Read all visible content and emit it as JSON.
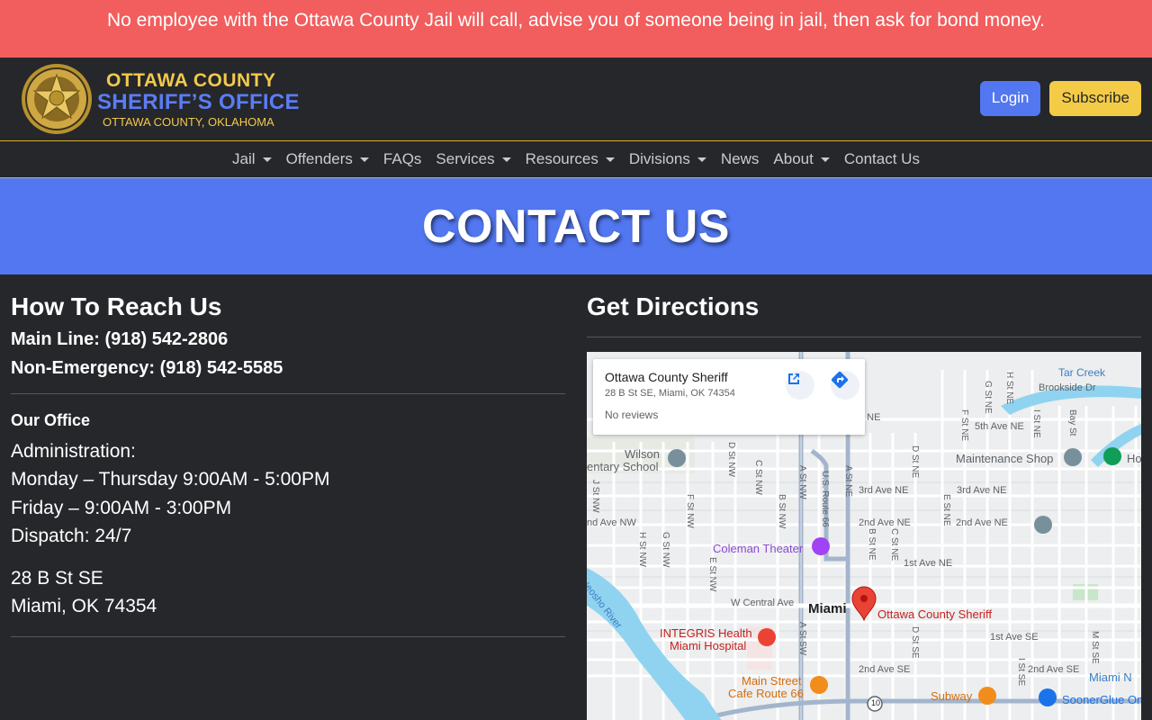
{
  "alert": {
    "text": "No employee with the Ottawa County Jail will call, advise you of someone being in jail, then ask for bond money."
  },
  "brand": {
    "line1": "OTTAWA COUNTY",
    "line2": "SHERIFF’S OFFICE",
    "line3": "OTTAWA COUNTY, OKLAHOMA",
    "badge_icon": "sheriff-star-badge"
  },
  "header": {
    "login": "Login",
    "subscribe": "Subscribe"
  },
  "nav": {
    "items": [
      {
        "label": "Jail",
        "dropdown": true
      },
      {
        "label": "Offenders",
        "dropdown": true
      },
      {
        "label": "FAQs",
        "dropdown": false
      },
      {
        "label": "Services",
        "dropdown": true
      },
      {
        "label": "Resources",
        "dropdown": true
      },
      {
        "label": "Divisions",
        "dropdown": true
      },
      {
        "label": "News",
        "dropdown": false
      },
      {
        "label": "About",
        "dropdown": true
      },
      {
        "label": "Contact Us",
        "dropdown": false
      }
    ]
  },
  "hero": {
    "title": "CONTACT US"
  },
  "reach": {
    "heading": "How To Reach Us",
    "main_line": "Main Line: (918) 542-2806",
    "non_emergency": "Non-Emergency: (918) 542-5585",
    "office_title": "Our Office",
    "hours": [
      "Administration:",
      "Monday – Thursday 9:00AM - 5:00PM",
      "Friday – 9:00AM - 3:00PM",
      "Dispatch: 24/7"
    ],
    "address": [
      "28 B St SE",
      "Miami, OK 74354"
    ]
  },
  "directions": {
    "heading": "Get Directions",
    "card": {
      "title": "Ottawa County Sheriff",
      "address": "28 B St SE, Miami, OK 74354",
      "reviews": "No reviews"
    },
    "map_labels": {
      "city": "Miami",
      "pin": "Ottawa County Sheriff",
      "coleman": "Coleman Theater",
      "hospital1": "INTEGRIS Health",
      "hospital2": "Miami Hospital",
      "mainstreet1": "Main Street",
      "mainstreet2": "Cafe Route 66",
      "subway": "Subway",
      "soonerglue": "SoonerGlue Om",
      "maintenance": "Maintenance Shop",
      "wilson1": "Wilson",
      "wilson2": "entary School",
      "tarcreek": "Tar Creek",
      "brookside": "Brookside Dr",
      "centralave": "W Central Ave",
      "neosho": "Neosho River",
      "ave5": "5th Ave NE",
      "ave3a": "3rd Ave NE",
      "ave3b": "3rd Ave NE",
      "ave2a": "2nd Ave NE",
      "ave2b": "2nd Ave NE",
      "ave2nw": "nd Ave NW",
      "ave1ne": "1st Ave NE",
      "ave1se": "1st Ave SE",
      "ave2se_a": "2nd Ave SE",
      "ave2se_b": "2nd Ave SE",
      "miami_n": "Miami N",
      "route10": "10",
      "ho": "Ho",
      "ne_top": "e NE",
      "st_a_nw": "A St NW",
      "st_a_ne": "A St NE",
      "st_a_sw": "A St SW",
      "us66": "U.S. Route 66",
      "st_b_ne": "B St NE",
      "st_c_ne": "C St NE",
      "st_d_ne": "D St NE",
      "st_e_ne": "E St NE",
      "st_f_ne": "F St NE",
      "st_g_ne": "G St NE",
      "st_h_ne": "H St NE",
      "st_i_ne": "I St NE",
      "st_d_se": "D St SE",
      "st_i_se": "I St SE",
      "st_m_se": "M St SE",
      "st_b_nw": "B St NW",
      "st_c_nw": "C St NW",
      "st_d_nw": "D St NW",
      "st_e_nw": "E St NW",
      "st_f_nw": "F St NW",
      "st_g_nw": "G St NW",
      "st_h_nw": "H St NW",
      "st_j_nw": "J St NW",
      "st_bay": "Bay St"
    }
  },
  "colors": {
    "alert_bg": "#f25d5d",
    "dark_bg": "#25272a",
    "accent_blue": "#5277f0",
    "accent_yellow": "#f4cb46"
  }
}
